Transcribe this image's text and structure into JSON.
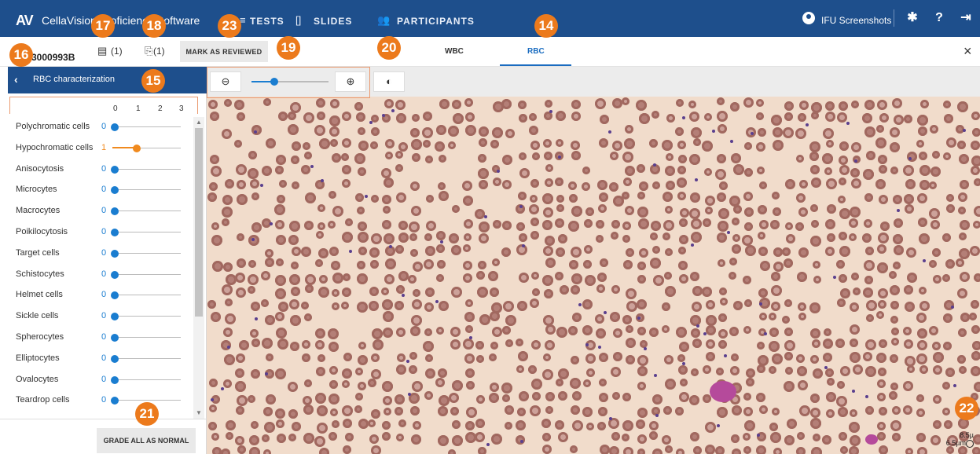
{
  "topbar": {
    "logo": "AV",
    "app_name": "CellaVision Proficiency Software",
    "nav": [
      {
        "label": "TESTS",
        "icon": "tests-icon"
      },
      {
        "label": "SLIDES",
        "icon": "slides-icon"
      },
      {
        "label": "PARTICIPANTS",
        "icon": "participants-icon"
      }
    ],
    "user": "IFU Screenshots",
    "color": "#1e4f8c"
  },
  "toolbar": {
    "slide_id": "3000993B",
    "comments_count": "(1)",
    "attachments_count": "(1)",
    "mark_reviewed_label": "MARK AS REVIEWED",
    "tabs": [
      {
        "label": "WBC",
        "active": false
      },
      {
        "label": "RBC",
        "active": true
      }
    ],
    "close_label": "×"
  },
  "panel": {
    "title": "RBC characterization",
    "scale": [
      "0",
      "1",
      "2",
      "3"
    ],
    "items": [
      {
        "label": "Polychromatic cells",
        "value": 0
      },
      {
        "label": "Hypochromatic cells",
        "value": 1
      },
      {
        "label": "Anisocytosis",
        "value": 0
      },
      {
        "label": "Microcytes",
        "value": 0
      },
      {
        "label": "Macrocytes",
        "value": 0
      },
      {
        "label": "Poikilocytosis",
        "value": 0
      },
      {
        "label": "Target cells",
        "value": 0
      },
      {
        "label": "Schistocytes",
        "value": 0
      },
      {
        "label": "Helmet cells",
        "value": 0
      },
      {
        "label": "Sickle cells",
        "value": 0
      },
      {
        "label": "Spherocytes",
        "value": 0
      },
      {
        "label": "Elliptocytes",
        "value": 0
      },
      {
        "label": "Ovalocytes",
        "value": 0
      },
      {
        "label": "Teardrop cells",
        "value": 0
      }
    ],
    "grade_all_label": "GRADE ALL AS NORMAL"
  },
  "viewer": {
    "zoom_level": 0.3,
    "scale_labels": [
      "8.5µ",
      "6.5µm"
    ]
  },
  "callouts": [
    "16",
    "17",
    "18",
    "23",
    "19",
    "20",
    "14",
    "15",
    "21",
    "22"
  ],
  "accent": "#ec7a1c"
}
